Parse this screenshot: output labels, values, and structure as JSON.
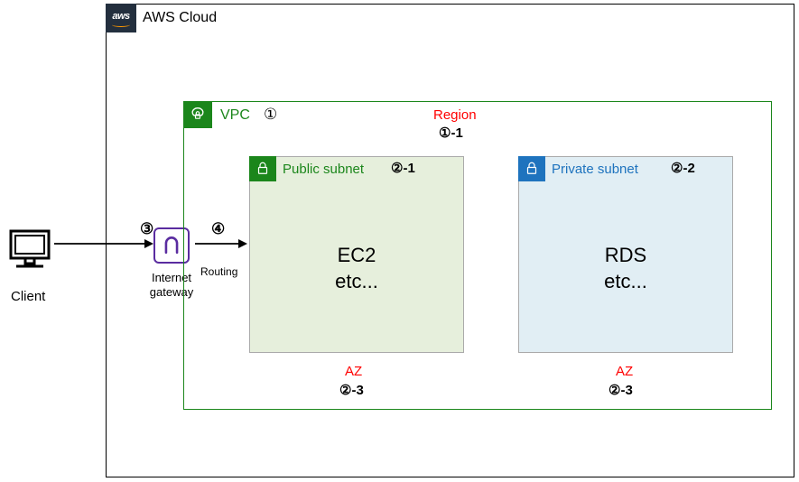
{
  "client": {
    "label": "Client"
  },
  "aws": {
    "label": "AWS Cloud",
    "logo": "aws"
  },
  "vpc": {
    "label": "VPC",
    "num": "①"
  },
  "region": {
    "label": "Region",
    "num": "①-1"
  },
  "public_subnet": {
    "label": "Public subnet",
    "num": "②-1",
    "content_l1": "EC2",
    "content_l2": "etc..."
  },
  "private_subnet": {
    "label": "Private subnet",
    "num": "②-2",
    "content_l1": "RDS",
    "content_l2": "etc..."
  },
  "az": {
    "label": "AZ",
    "num": "②-3"
  },
  "igw": {
    "label_l1": "Internet",
    "label_l2": "gateway"
  },
  "routing": {
    "label": "Routing"
  },
  "step3": "③",
  "step4": "④"
}
